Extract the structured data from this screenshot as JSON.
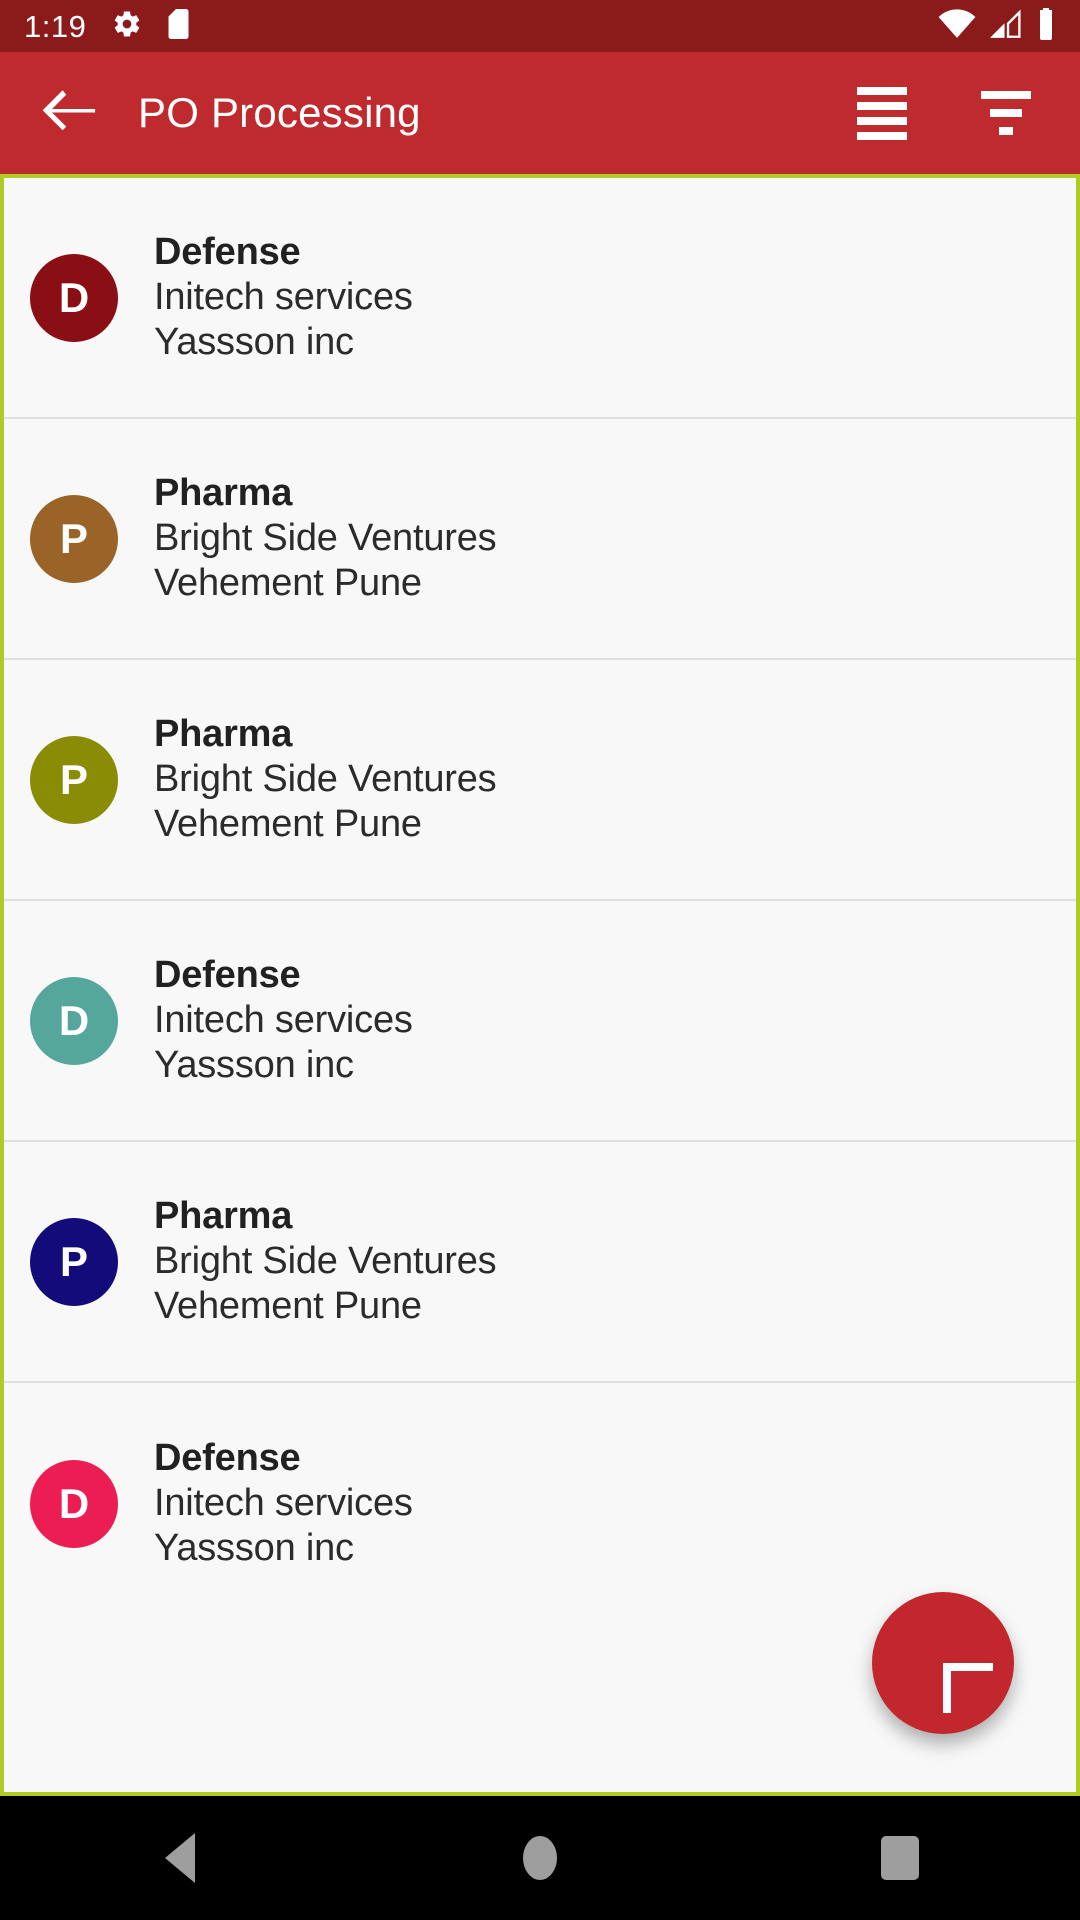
{
  "status_bar": {
    "time": "1:19",
    "left_icons": [
      "gear-icon",
      "sd-card-icon"
    ],
    "right_icons": [
      "wifi-icon",
      "cellular-signal-icon",
      "battery-icon"
    ],
    "background_color": "#8B1A1A"
  },
  "app_bar": {
    "back_label": "back-arrow-icon",
    "title": "PO Processing",
    "actions": [
      {
        "name": "list-view-icon",
        "label": "List"
      },
      {
        "name": "filter-icon",
        "label": "Filter"
      }
    ],
    "background_color": "#BE2A2E"
  },
  "frame": {
    "border_color": "#AFCC24"
  },
  "list": {
    "items": [
      {
        "avatar_letter": "D",
        "avatar_color": "#8A0F14",
        "title": "Defense",
        "line1": "Initech services",
        "line2": "Yassson inc"
      },
      {
        "avatar_letter": "P",
        "avatar_color": "#9A6428",
        "title": "Pharma",
        "line1": "Bright Side Ventures",
        "line2": "Vehement Pune"
      },
      {
        "avatar_letter": "P",
        "avatar_color": "#8A8C05",
        "title": "Pharma",
        "line1": "Bright Side Ventures",
        "line2": "Vehement Pune"
      },
      {
        "avatar_letter": "D",
        "avatar_color": "#55A79C",
        "title": "Defense",
        "line1": "Initech services",
        "line2": "Yassson inc"
      },
      {
        "avatar_letter": "P",
        "avatar_color": "#130B79",
        "title": "Pharma",
        "line1": "Bright Side Ventures",
        "line2": "Vehement Pune"
      },
      {
        "avatar_letter": "D",
        "avatar_color": "#EC1D53",
        "title": "Defense",
        "line1": "Initech services",
        "line2": "Yassson inc"
      }
    ]
  },
  "fab": {
    "icon": "plus-icon",
    "color": "#C1272D"
  },
  "nav_bar": {
    "buttons": [
      "back-triangle-icon",
      "home-circle-icon",
      "recents-square-icon"
    ]
  }
}
